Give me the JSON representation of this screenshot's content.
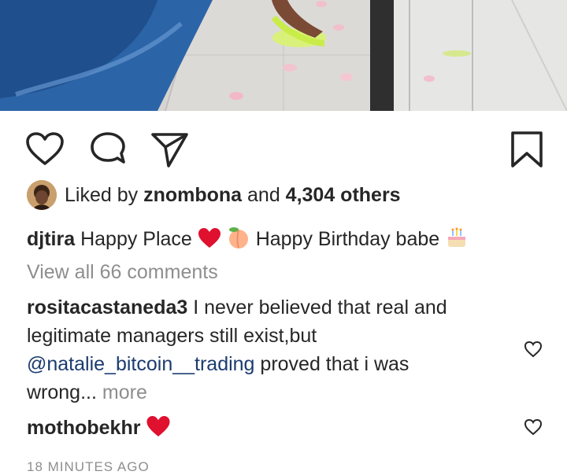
{
  "post": {
    "likes": {
      "prefix": "Liked by ",
      "user": "znombona",
      "middle": " and ",
      "count": "4,304 others"
    },
    "caption": {
      "user": "djtira",
      "text_before": "Happy Place",
      "text_after": "Happy Birthday babe"
    },
    "view_comments": "View all 66 comments",
    "comments": [
      {
        "user": "rositacastaneda3",
        "line1": "I never believed that real and",
        "line2": "legitimate managers still exist,but",
        "mention": "@natalie_bitcoin__trading",
        "line3_rest": " proved that i was",
        "line4": "wrong...",
        "more": " more"
      },
      {
        "user": "mothobekhr"
      }
    ],
    "timestamp": "18 MINUTES AGO"
  },
  "icons": {
    "like": "heart-outline-icon",
    "comment": "comment-bubble-icon",
    "share": "paper-plane-icon",
    "save": "bookmark-icon",
    "red_heart": "red-heart-emoji",
    "peach": "peach-emoji",
    "cake": "birthday-cake-emoji"
  },
  "colors": {
    "text": "#262626",
    "muted": "#8e8e8e",
    "mention": "#1b3b6f",
    "heart_red": "#e0102f"
  }
}
